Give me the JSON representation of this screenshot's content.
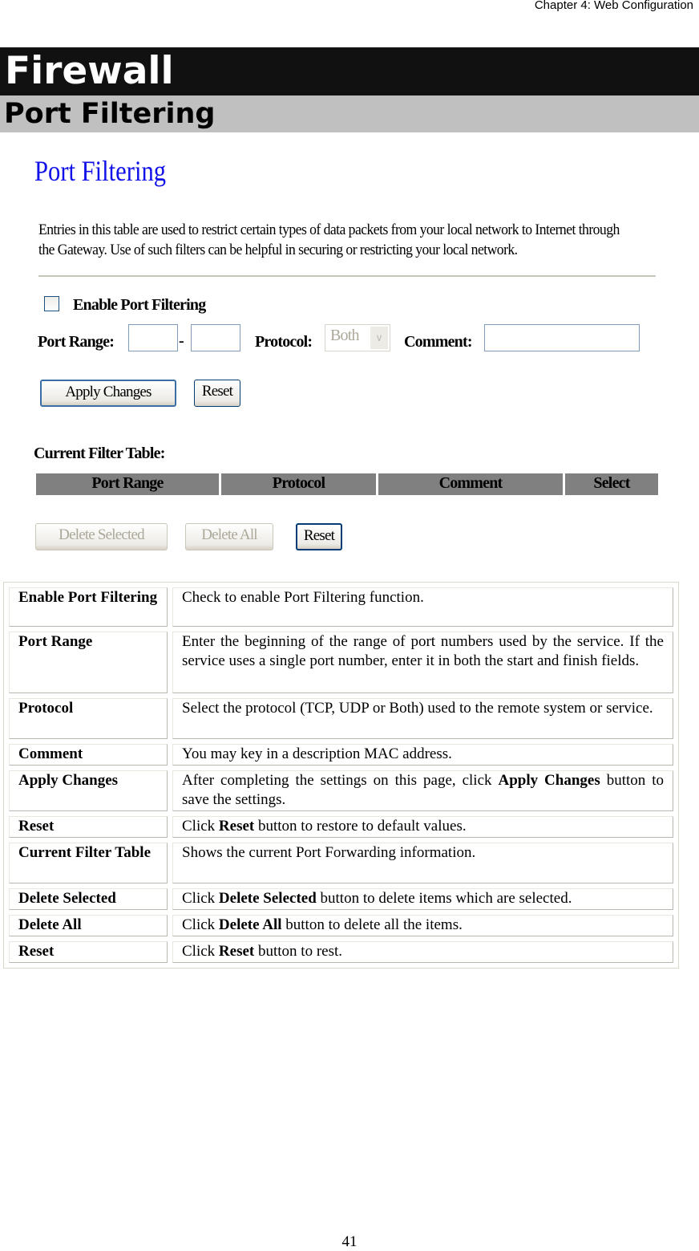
{
  "header": {
    "chapter": "Chapter 4: Web Configuration",
    "title": "Firewall",
    "subtitle": "Port Filtering"
  },
  "screenshot": {
    "title": "Port Filtering",
    "intro": "Entries in this table are used to restrict certain types of data packets from your local network to Internet through the Gateway. Use of such filters can be helpful in securing or restricting your local network.",
    "enable_label": "Enable Port Filtering",
    "enable_checked": false,
    "port_range_label": "Port Range:",
    "dash": "-",
    "protocol_label": "Protocol:",
    "protocol_value": "Both",
    "comment_label": "Comment:",
    "apply_label": "Apply Changes",
    "reset_label": "Reset",
    "table_label": "Current Filter Table:",
    "columns": [
      "Port Range",
      "Protocol",
      "Comment",
      "Select"
    ],
    "delete_selected_label": "Delete Selected",
    "delete_all_label": "Delete All",
    "reset2_label": "Reset"
  },
  "desc_table": [
    {
      "key": "Enable Port Filtering",
      "pre": "Check to enable Port Filtering function.",
      "bold": "",
      "post": ""
    },
    {
      "key": "Port Range",
      "pre": "Enter the beginning of the range of port numbers used by the service. If the service uses a single port number, enter it in both the start and finish fields.",
      "bold": "",
      "post": ""
    },
    {
      "key": "Protocol",
      "pre": "Select the protocol (TCP, UDP or Both) used to the remote system or service.",
      "bold": "",
      "post": ""
    },
    {
      "key": "Comment",
      "pre": "You may key in a description MAC address.",
      "bold": "",
      "post": ""
    },
    {
      "key": "Apply Changes",
      "pre": "After completing the settings on this page, click ",
      "bold": "Apply Changes",
      "post": " button to save the settings."
    },
    {
      "key": "Reset",
      "pre": "Click ",
      "bold": "Reset",
      "post": " button to restore to default values."
    },
    {
      "key": "Current Filter Table",
      "pre": "Shows the current Port Forwarding information.",
      "bold": "",
      "post": ""
    },
    {
      "key": "Delete Selected",
      "pre": "Click ",
      "bold": "Delete Selected",
      "post": " button to delete items which are selected."
    },
    {
      "key": "Delete All",
      "pre": "Click ",
      "bold": "Delete All",
      "post": " button to delete all the items."
    },
    {
      "key": "Reset",
      "pre": "Click ",
      "bold": "Reset",
      "post": " button to rest."
    }
  ],
  "page_number": "41"
}
